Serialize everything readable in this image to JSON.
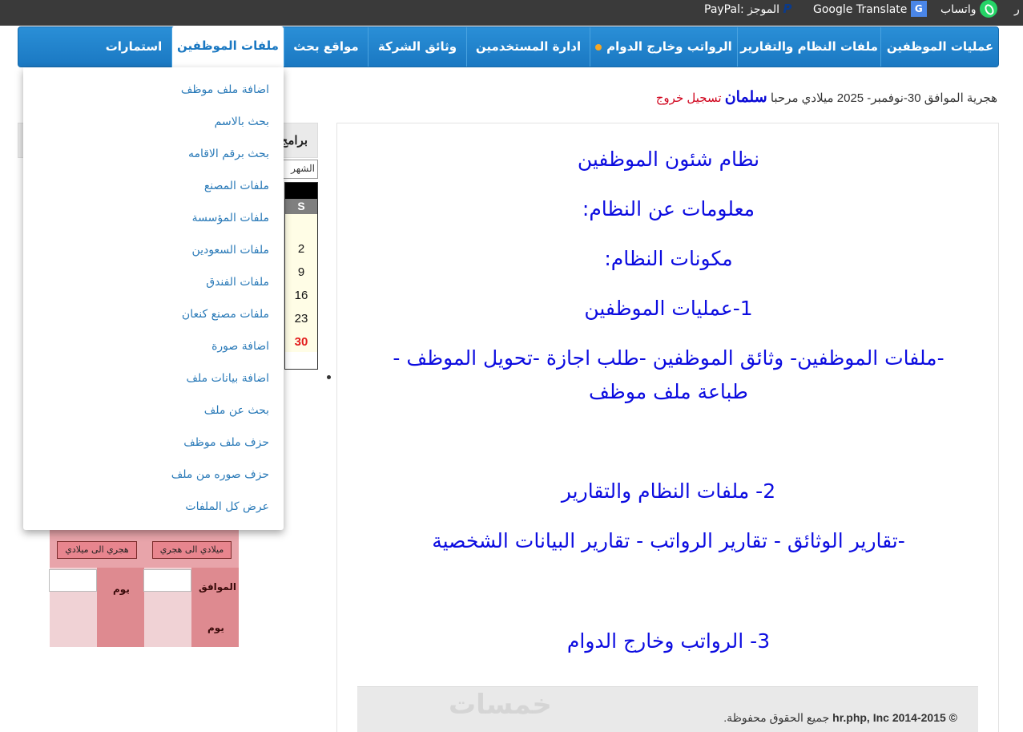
{
  "topbar": {
    "partial_left": "ر",
    "whatsapp_label": "واتساب",
    "google_translate_label": "Google Translate",
    "paypal_label": "PayPal: الموجز",
    "bg_color": "#3a3a3a"
  },
  "nav": {
    "tabs": [
      {
        "label": "عمليات الموظفين"
      },
      {
        "label": "ملفات النظام والتقارير"
      },
      {
        "label": "الرواتب وخارج الدوام"
      },
      {
        "label": "ادارة المستخدمين"
      },
      {
        "label": "وثائق الشركة"
      },
      {
        "label": "مواقع بحث"
      },
      {
        "label": "ملفات الموظفين"
      },
      {
        "label": "استمارات"
      }
    ],
    "active_tab": "ملفات الموظفين",
    "accent_color": "#1a78c2"
  },
  "greeting": {
    "date_text": "هجرية الموافق 30-نوفمبر- 2025 ميلادي مرحبا",
    "username": "سلمان",
    "logout": "تسجيل خروج"
  },
  "dropdown": {
    "items": [
      "اضافة ملف موظف",
      "بحث بالاسم",
      "بحث برقم الاقامه",
      "ملفات المصنع",
      "ملفات المؤسسة",
      "ملفات السعودين",
      "ملفات الفندق",
      "ملفات مصنع كنعان",
      "اضافة صورة",
      "اضافة بيانات ملف",
      "بحث عن ملف",
      "حزف ملف موظف",
      "حزف صوره من ملف",
      "عرض كل الملفات"
    ]
  },
  "sidebar": {
    "box_title": "برامج",
    "month_value": "الشهر",
    "calendar": {
      "header": "S",
      "days": [
        "2",
        "9",
        "16",
        "23",
        "30"
      ],
      "today": "30"
    },
    "converter": {
      "btn_g2h": "ميلادي الى هجري",
      "btn_h2g": "هجري الى ميلادي",
      "label_corresponds": "الموافق",
      "label_day": "يوم",
      "label_day2": "يوم"
    }
  },
  "main": {
    "lines": [
      "نظام شئون الموظفين",
      "معلومات عن النظام:",
      "مكونات النظام:",
      "1-عمليات الموظفين",
      "-ملفات الموظفين- وثائق الموظفين -طلب اجازة -تحويل الموظف -",
      "طباعة ملف موظف",
      "2- ملفات النظام والتقارير",
      "-تقارير الوثائق - تقارير الرواتب - تقارير البيانات الشخصية",
      "3- الرواتب وخارج الدوام"
    ],
    "text_color": "#0c0ce0"
  },
  "footer": {
    "copyright_bold": "© hr.php, Inc 2014-2015",
    "copyright_rest": "جميع الحقوق محفوظة.",
    "watermark": "خمسات"
  }
}
